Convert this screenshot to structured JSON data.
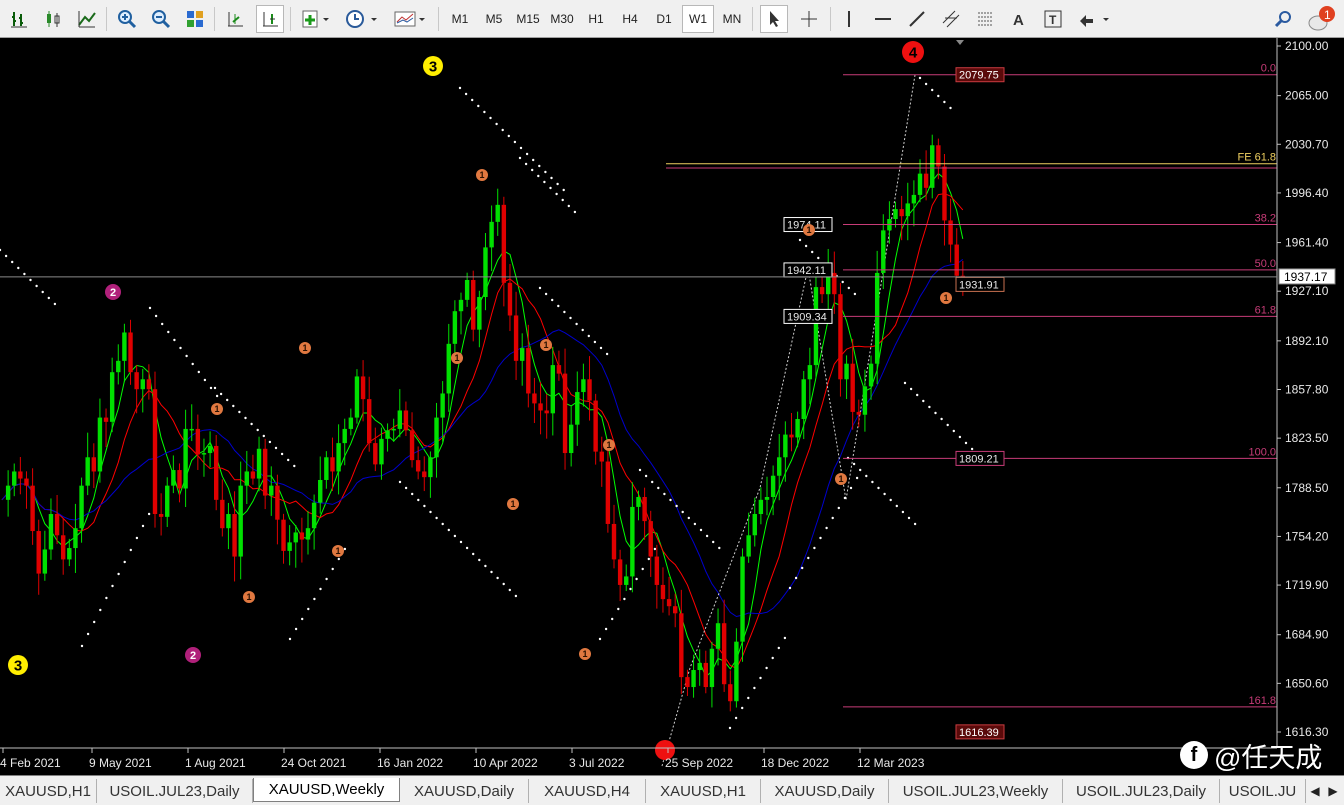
{
  "toolbar": {
    "timeframes": [
      "M1",
      "M5",
      "M15",
      "M30",
      "H1",
      "H4",
      "D1",
      "W1",
      "MN"
    ],
    "active_timeframe": "W1",
    "notification_count": "1"
  },
  "chart": {
    "symbol": "XAUUSD",
    "period": "Weekly",
    "current_price": "1937.17",
    "price_axis": [
      "2100.00",
      "2065.00",
      "2030.70",
      "1996.40",
      "1961.40",
      "1927.10",
      "1892.10",
      "1857.80",
      "1823.50",
      "1788.50",
      "1754.20",
      "1719.90",
      "1684.90",
      "1650.60",
      "1616.30"
    ],
    "time_axis": [
      "4 Feb 2021",
      "9 May 2021",
      "1 Aug 2021",
      "24 Oct 2021",
      "16 Jan 2022",
      "10 Apr 2022",
      "3 Jul 2022",
      "25 Sep 2022",
      "18 Dec 2022",
      "12 Mar 2023"
    ],
    "fib_levels": [
      {
        "label": "0.0",
        "price": "2079.75"
      },
      {
        "label": "FE 61.8",
        "price": ""
      },
      {
        "label": "38.2",
        "price": "1974.11"
      },
      {
        "label": "50.0",
        "price": "1942.11"
      },
      {
        "label": "61.8",
        "price": "1909.34"
      },
      {
        "label": "100.0",
        "price": "1809.21"
      },
      {
        "label": "161.8",
        "price": "1616.39"
      }
    ],
    "extra_price_labels": [
      "1931.91"
    ],
    "wave_labels": {
      "yellow": [
        "3",
        "3"
      ],
      "red": [
        "4"
      ],
      "purple": [
        "2",
        "2"
      ],
      "orange": "1"
    },
    "colors": {
      "bull": "#00e000",
      "bear": "#e00000",
      "ma_fast": "#00ff00",
      "ma_mid": "#ff0000",
      "ma_slow": "#0000cc",
      "fib": "#c83c78",
      "fe": "#f0d060"
    }
  },
  "tabs": [
    "XAUUSD,H1",
    "USOIL.JUL23,Daily",
    "XAUUSD,Weekly",
    "XAUUSD,Daily",
    "XAUUSD,H4",
    "XAUUSD,H1",
    "XAUUSD,Daily",
    "USOIL.JUL23,Weekly",
    "USOIL.JUL23,Daily",
    "USOIL.JU"
  ],
  "active_tab": "XAUUSD,Weekly",
  "watermark": {
    "icon": "f",
    "text": "@任天成"
  }
}
